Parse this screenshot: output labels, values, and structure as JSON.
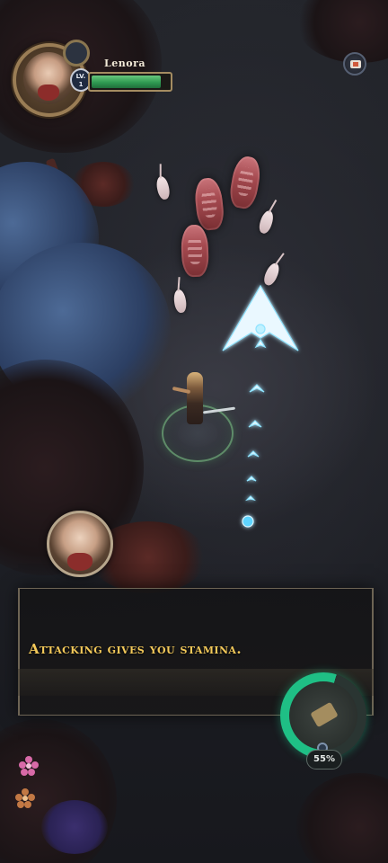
{
  "player": {
    "name": "Lenora",
    "level_label": "LV.",
    "level": "1",
    "health_fraction": 0.9
  },
  "tutorial": {
    "message": "Attacking gives you stamina."
  },
  "stamina": {
    "percent_label": "55%",
    "fraction": 0.55
  },
  "colors": {
    "dialog_text": "#f3c95a",
    "health": "#2f9a52",
    "stamina": "#1fbf85",
    "aim_indicator": "#8fe3ff"
  },
  "icons": {
    "top_right_button": "map-icon",
    "skill": "sword-skill-icon"
  }
}
